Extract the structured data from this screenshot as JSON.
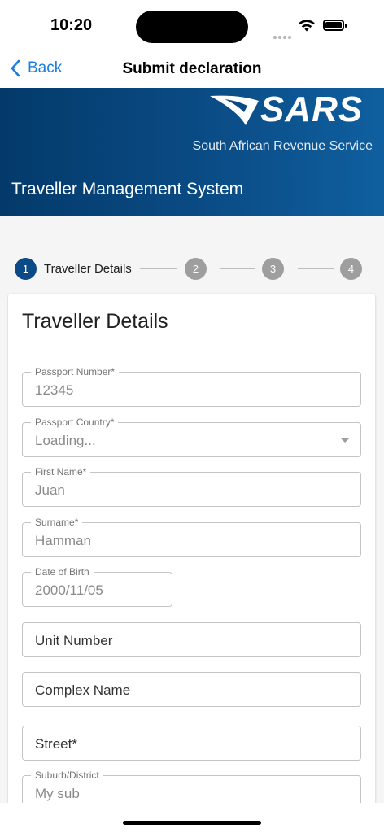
{
  "status": {
    "time": "10:20"
  },
  "nav": {
    "back_label": "Back",
    "title": "Submit declaration"
  },
  "banner": {
    "logo_text": "SARS",
    "subtitle": "South African Revenue Service",
    "title": "Traveller Management System"
  },
  "stepper": {
    "steps": [
      {
        "number": "1",
        "label": "Traveller Details",
        "active": true
      },
      {
        "number": "2",
        "label": "",
        "active": false
      },
      {
        "number": "3",
        "label": "",
        "active": false
      },
      {
        "number": "4",
        "label": "",
        "active": false
      }
    ]
  },
  "form": {
    "title": "Traveller Details",
    "fields": {
      "passport_number": {
        "label": "Passport Number*",
        "value": "12345"
      },
      "passport_country": {
        "label": "Passport Country*",
        "value": "Loading..."
      },
      "first_name": {
        "label": "First Name*",
        "value": "Juan"
      },
      "surname": {
        "label": "Surname*",
        "value": "Hamman"
      },
      "dob": {
        "label": "Date of Birth",
        "value": "2000/11/05"
      },
      "unit_number": {
        "placeholder": "Unit Number"
      },
      "complex_name": {
        "placeholder": "Complex Name"
      },
      "street": {
        "placeholder": "Street*"
      },
      "suburb": {
        "label": "Suburb/District",
        "value": "My sub"
      }
    }
  },
  "colors": {
    "accent": "#1a7ee0",
    "banner_dark": "#033a6a",
    "step_active": "#0b4a84",
    "step_inactive": "#9e9e9e"
  }
}
